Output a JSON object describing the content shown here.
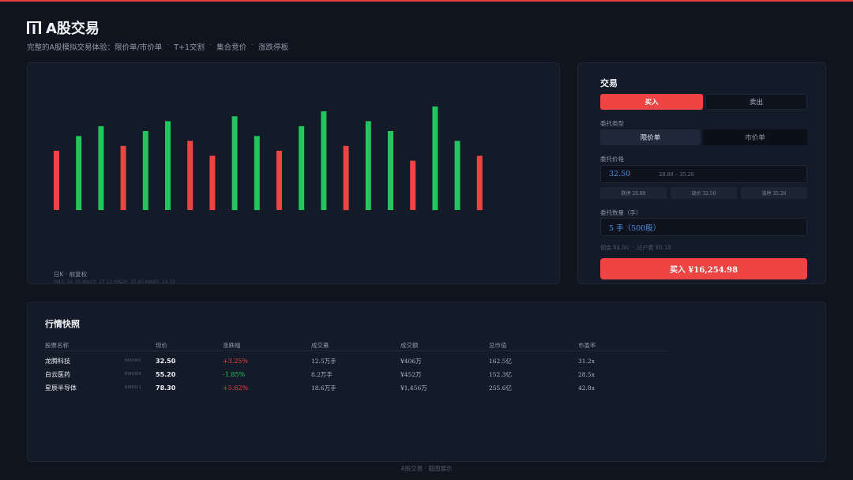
{
  "app": {
    "title": "A股交易",
    "logo_icon": "market-logo-icon",
    "subtitle": [
      "完整的A股模拟交易体验：限价单/市价单",
      "T+1交割",
      "集合竞价",
      "涨跌停板"
    ],
    "subtitle_sep": "·"
  },
  "colors": {
    "up": "#ef4444",
    "down": "#22c55e",
    "accent": "#ef4444",
    "price_blue": "#4a90e2"
  },
  "chart_data": {
    "type": "bar",
    "bars": [
      {
        "value": 6.0,
        "dir": "up"
      },
      {
        "value": 7.5,
        "dir": "down"
      },
      {
        "value": 8.5,
        "dir": "down"
      },
      {
        "value": 6.5,
        "dir": "up"
      },
      {
        "value": 8.0,
        "dir": "down"
      },
      {
        "value": 9.0,
        "dir": "down"
      },
      {
        "value": 7.0,
        "dir": "up"
      },
      {
        "value": 5.5,
        "dir": "up"
      },
      {
        "value": 9.5,
        "dir": "down"
      },
      {
        "value": 7.5,
        "dir": "down"
      },
      {
        "value": 6.0,
        "dir": "up"
      },
      {
        "value": 8.5,
        "dir": "down"
      },
      {
        "value": 10.0,
        "dir": "down"
      },
      {
        "value": 6.5,
        "dir": "up"
      },
      {
        "value": 9.0,
        "dir": "down"
      },
      {
        "value": 8.0,
        "dir": "down"
      },
      {
        "value": 5.0,
        "dir": "up"
      },
      {
        "value": 10.5,
        "dir": "down"
      },
      {
        "value": 7.0,
        "dir": "down"
      },
      {
        "value": 5.5,
        "dir": "up"
      }
    ],
    "ylim": [
      0,
      12
    ],
    "grid": false,
    "period_label": "日K · 前复权",
    "ma_label": "MA5: 26.35 MA10: 27.12 MA20: 25.80 MA60: 24.10"
  },
  "trade": {
    "title": "交易",
    "buy_tab": "买入",
    "sell_tab": "卖出",
    "order_type_label": "委托类型",
    "limit_order": "限价单",
    "market_order": "市价单",
    "price_label": "委托价格",
    "price_value": "32.50",
    "price_range": "28.88 – 35.26",
    "chips": [
      "跌停 28.88",
      "现价 32.50",
      "涨停 35.26"
    ],
    "qty_label": "委托数量（手）",
    "qty_value": "5 手（500股）",
    "fee_commission": "佣金 ¥4.86",
    "fee_sep": "·",
    "fee_transfer": "过户费 ¥0.18",
    "submit_label": "买入 ¥16,254.98"
  },
  "market": {
    "title": "行情快照",
    "headers": [
      "股票名称",
      "现价",
      "涨跌幅",
      "成交量",
      "成交额",
      "总市值",
      "市盈率"
    ],
    "rows": [
      {
        "name": "龙腾科技",
        "code": "600001",
        "price": "32.50",
        "change": "+3.25%",
        "dir": "up",
        "volume": "12.5万手",
        "amount": "¥406万",
        "cap": "162.5亿",
        "pe": "31.2x"
      },
      {
        "name": "白云医药",
        "code": "600004",
        "price": "55.20",
        "change": "-1.85%",
        "dir": "down",
        "volume": "8.2万手",
        "amount": "¥452万",
        "cap": "152.3亿",
        "pe": "28.5x"
      },
      {
        "name": "星辰半导体",
        "code": "600011",
        "price": "78.30",
        "change": "+5.62%",
        "dir": "up",
        "volume": "18.6万手",
        "amount": "¥1,456万",
        "cap": "255.6亿",
        "pe": "42.8x"
      }
    ]
  },
  "footer": {
    "text": "A股交易 · 截图展示"
  }
}
